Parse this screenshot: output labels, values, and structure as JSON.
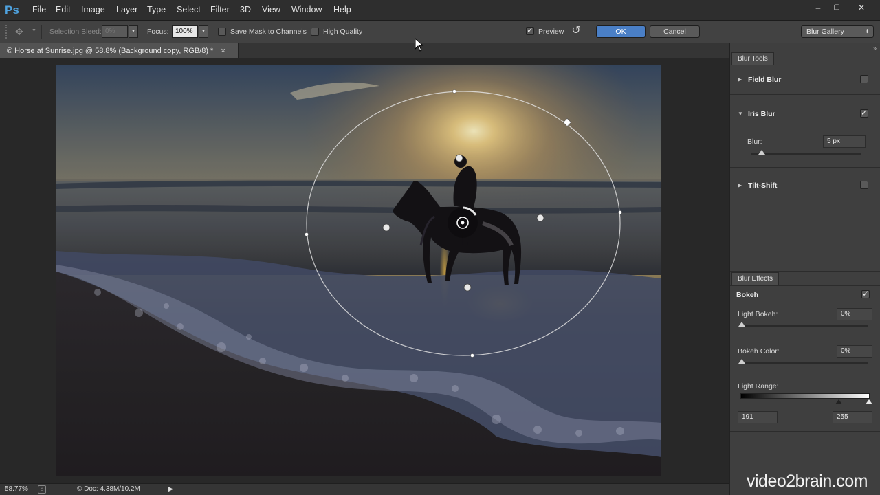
{
  "app": {
    "logo": "Ps",
    "menu": [
      "File",
      "Edit",
      "Image",
      "Layer",
      "Type",
      "Select",
      "Filter",
      "3D",
      "View",
      "Window",
      "Help"
    ],
    "window_controls": [
      "–",
      "▢",
      "✕"
    ]
  },
  "options_bar": {
    "selection_bleed_label": "Selection Bleed:",
    "selection_bleed_value": "0%",
    "focus_label": "Focus:",
    "focus_value": "100%",
    "save_mask_label": "Save Mask to Channels",
    "high_quality_label": "High Quality",
    "preview_label": "Preview",
    "preview_checked": true,
    "ok_label": "OK",
    "cancel_label": "Cancel",
    "workspace_value": "Blur Gallery"
  },
  "document": {
    "tab_title": "Horse at Sunrise.jpg @ 58.8% (Background copy, RGB/8) *",
    "tab_close": "×",
    "tab_icon": "©"
  },
  "blur_tools": {
    "tab_label": "Blur Tools",
    "field_blur": {
      "label": "Field Blur",
      "checked": false
    },
    "iris_blur": {
      "label": "Iris Blur",
      "checked": true,
      "blur_label": "Blur:",
      "blur_value": "5 px",
      "blur_fraction": 0.08
    },
    "tilt_shift": {
      "label": "Tilt-Shift",
      "checked": false
    }
  },
  "blur_effects": {
    "tab_label": "Blur Effects",
    "bokeh": {
      "label": "Bokeh",
      "checked": true
    },
    "light_bokeh_label": "Light Bokeh:",
    "light_bokeh_value": "0%",
    "bokeh_color_label": "Bokeh Color:",
    "bokeh_color_value": "0%",
    "light_range_label": "Light Range:",
    "light_range_low": "191",
    "light_range_high": "255"
  },
  "status": {
    "zoom": "58.77%",
    "doc_info": "© Doc: 4.38M/10.2M"
  },
  "watermark": "video2brain.com",
  "colors": {
    "accent_blue": "#4a7fc6",
    "ps_logo": "#4fa3e0"
  }
}
